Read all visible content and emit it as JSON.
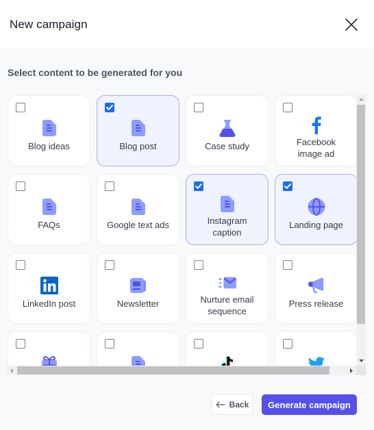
{
  "header": {
    "title": "New campaign",
    "close_icon": "close-icon"
  },
  "subtitle": "Select content to be generated for you",
  "colors": {
    "accent": "#5551e8",
    "checkbox_checked": "#1a6cf0",
    "selected_card_bg": "#eff3fe",
    "selected_card_border": "#a8aef0",
    "icon_light": "#8c9cff",
    "icon_dark": "#5551e8"
  },
  "content_types": [
    {
      "label": "Blog ideas",
      "icon": "document-icon",
      "checked": false
    },
    {
      "label": "Blog post",
      "icon": "document-icon",
      "checked": true
    },
    {
      "label": "Case study",
      "icon": "flask-icon",
      "checked": false
    },
    {
      "label": "Facebook image ad",
      "icon": "facebook-icon",
      "checked": false
    },
    {
      "label": "FAQs",
      "icon": "document-icon",
      "checked": false
    },
    {
      "label": "Google text ads",
      "icon": "document-icon",
      "checked": false
    },
    {
      "label": "Instagram caption",
      "icon": "document-icon",
      "checked": true
    },
    {
      "label": "Landing page",
      "icon": "globe-icon",
      "checked": true
    },
    {
      "label": "LinkedIn post",
      "icon": "linkedin-icon",
      "checked": false
    },
    {
      "label": "Newsletter",
      "icon": "newspaper-icon",
      "checked": false
    },
    {
      "label": "Nurture email sequence",
      "icon": "email-icon",
      "checked": false
    },
    {
      "label": "Press release",
      "icon": "megaphone-icon",
      "checked": false
    },
    {
      "label": "",
      "icon": "gift-icon",
      "checked": false
    },
    {
      "label": "",
      "icon": "document-icon",
      "checked": false
    },
    {
      "label": "",
      "icon": "tiktok-icon",
      "checked": false
    },
    {
      "label": "",
      "icon": "twitter-icon",
      "checked": false
    }
  ],
  "footer": {
    "back_label": "Back",
    "generate_label": "Generate campaign"
  }
}
